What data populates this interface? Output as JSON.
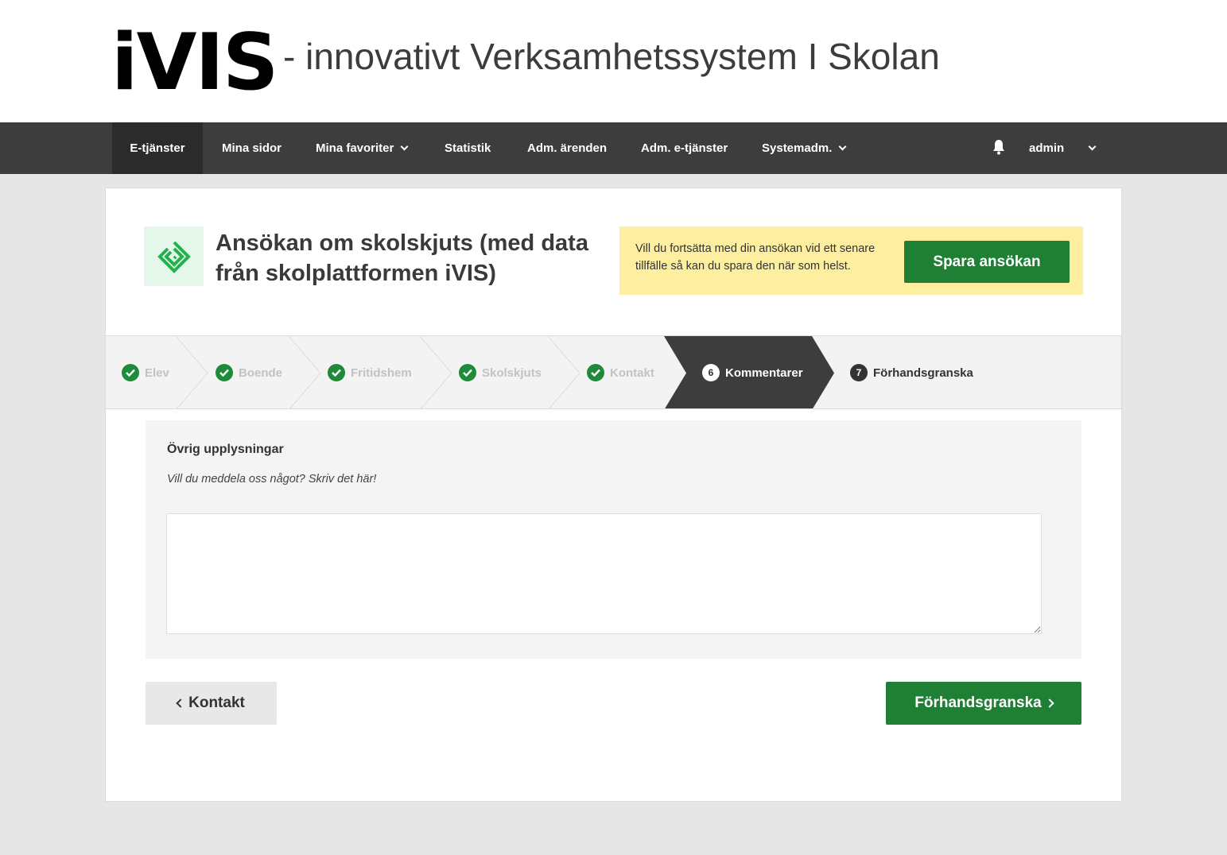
{
  "header": {
    "logo": "iVIS",
    "tagline": "- innovativt Verksamhetssystem I Skolan"
  },
  "nav": {
    "items": [
      {
        "label": "E-tjänster",
        "active": true
      },
      {
        "label": "Mina sidor"
      },
      {
        "label": "Mina favoriter",
        "dropdown": true
      },
      {
        "label": "Statistik"
      },
      {
        "label": "Adm. ärenden"
      },
      {
        "label": "Adm. e-tjänster"
      },
      {
        "label": "Systemadm.",
        "dropdown": true
      }
    ],
    "notification_icon": "bell-icon",
    "user": "admin"
  },
  "form": {
    "icon": "form-logo-icon",
    "title": "Ansökan om skolskjuts (med data från skolplattformen iVIS)",
    "save_notice": "Vill du fortsätta med din ansökan vid ett senare tillfälle så kan du spara den när som helst.",
    "save_button": "Spara ansökan"
  },
  "steps": [
    {
      "label": "Elev",
      "status": "done"
    },
    {
      "label": "Boende",
      "status": "done"
    },
    {
      "label": "Fritidshem",
      "status": "done"
    },
    {
      "label": "Skolskjuts",
      "status": "done"
    },
    {
      "label": "Kontakt",
      "status": "done"
    },
    {
      "label": "Kommentarer",
      "status": "current",
      "number": "6"
    },
    {
      "label": "Förhandsgranska",
      "status": "upcoming",
      "number": "7"
    }
  ],
  "section": {
    "label": "Övrig upplysningar",
    "help": "Vill du meddela oss något? Skriv det här!",
    "textarea_value": ""
  },
  "buttons": {
    "back": "Kontakt",
    "next": "Förhandsgranska"
  },
  "colors": {
    "nav_bg": "#3d3d3d",
    "primary_green": "#1f7f35",
    "notice_yellow": "#fdeea0",
    "active_step": "#3d3d3d"
  }
}
